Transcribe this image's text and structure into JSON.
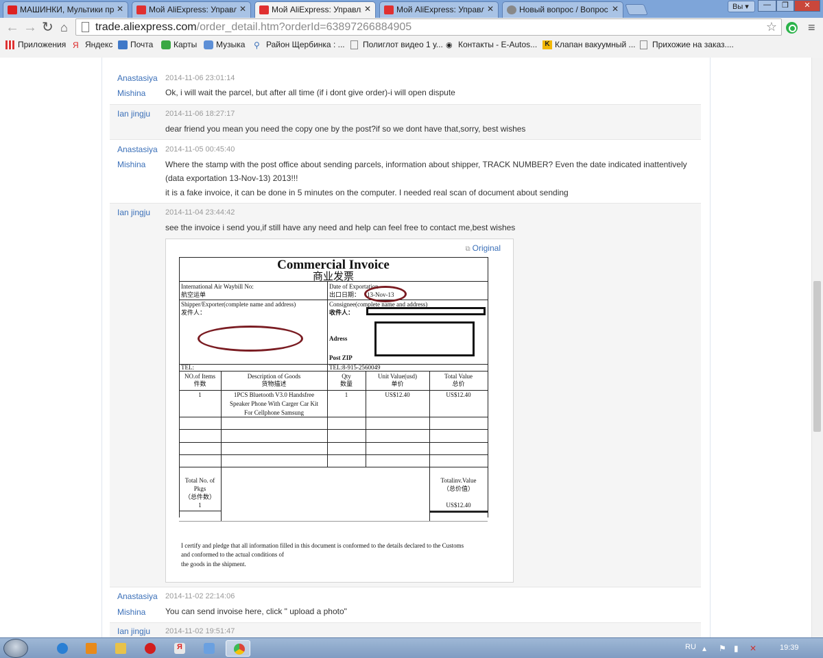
{
  "browser": {
    "tabs": [
      {
        "title": "МАШИНКИ, Мультики пр",
        "icon": "youtube-icon",
        "color": "#d22"
      },
      {
        "title": "Мой AliExpress: Управлят",
        "icon": "aliexpress-cart-icon",
        "color": "#e03030"
      },
      {
        "title": "Мой AliExpress: Управлят",
        "icon": "aliexpress-cart-icon",
        "color": "#e03030"
      },
      {
        "title": "Мой AliExpress: Управлят",
        "icon": "aliexpress-cart-icon",
        "color": "#e03030"
      },
      {
        "title": "Новый вопрос / Вопрос",
        "icon": "question-site-icon",
        "color": "#666"
      }
    ],
    "active_tab": 2,
    "profile_label": "Вы",
    "url_host": "trade.aliexpress.com",
    "url_path": "/order_detail.htm?orderId=63897266884905",
    "bookmarks": [
      {
        "label": "Приложения",
        "icon": "apps-grid-icon"
      },
      {
        "label": "Яндекс",
        "icon": "yandex-icon"
      },
      {
        "label": "Почта",
        "icon": "mail-icon"
      },
      {
        "label": "Карты",
        "icon": "maps-icon"
      },
      {
        "label": "Музыка",
        "icon": "music-icon"
      },
      {
        "label": "Район Щербинка : ...",
        "icon": "pin-icon"
      },
      {
        "label": "Полиглот видео 1 у...",
        "icon": "page-icon"
      },
      {
        "label": "Контакты - E-Autos...",
        "icon": "eye-icon"
      },
      {
        "label": "Клапан вакуумный ...",
        "icon": "k-icon"
      },
      {
        "label": "Прихожие на заказ....",
        "icon": "page-icon"
      }
    ]
  },
  "messages": [
    {
      "sender": [
        "Anastasiya",
        "Mishina"
      ],
      "time": "2014-11-06 23:01:14",
      "role": "buyer",
      "lines": [
        "Ok, i will wait the parcel, but after all time (if i dont give order)-i will open dispute"
      ]
    },
    {
      "sender": [
        "Ian jingju"
      ],
      "time": "2014-11-06 18:27:17",
      "role": "seller",
      "lines": [
        "dear friend you mean you need the copy one by the post?if so we dont have that,sorry, best wishes"
      ]
    },
    {
      "sender": [
        "Anastasiya",
        "Mishina"
      ],
      "time": "2014-11-05 00:45:40",
      "role": "buyer",
      "lines": [
        "Where the stamp with the post office about sending parcels, information about shipper, TRACK NUMBER? Even the date indicated inattentively (data exportation 13-Nov-13) 2013!!!",
        "it is a fake invoice, it can be done in 5 minutes on the computer. I needed real scan of document about sending"
      ]
    },
    {
      "sender": [
        "Ian jingju"
      ],
      "time": "2014-11-04 23:44:42",
      "role": "seller",
      "lines": [
        "see the invoice i send you,if still have any need and help can feel free to contact me,best wishes"
      ]
    },
    {
      "sender": [
        "Anastasiya",
        "Mishina"
      ],
      "time": "2014-11-02 22:14:06",
      "role": "buyer",
      "lines": [
        "You can send invoise here, click \" upload a photo\""
      ]
    },
    {
      "sender": [
        "Ian jingju"
      ],
      "time": "2014-11-02 19:51:47",
      "role": "seller",
      "lines": [
        ""
      ]
    }
  ],
  "attachment": {
    "original_link": "Original",
    "invoice": {
      "title": "Commercial Invoice",
      "title_cn": "商业发票",
      "waybill_label": "International Air Waybill No:",
      "waybill_label_cn": "航空运单",
      "date_label": "Date of Exportation",
      "date_label_cn": "出口日期：",
      "date_value": "13-Nov-13",
      "shipper_label": "Shipper/Exporter(complete name and address)",
      "shipper_label_cn": "发件人：",
      "consignee_label": "Consignee(complete name and address)",
      "consignee_label_cn": "收件人：",
      "address_label": "Adress",
      "zip_label": "Post ZIP",
      "tel_left": "TEL:",
      "tel_right": "TEL:8-915-2560049",
      "headers": [
        [
          "NO.of Items",
          "件数"
        ],
        [
          "Description of Goods",
          "货物描述"
        ],
        [
          "Qty",
          "数量"
        ],
        [
          "Unit Value(usd)",
          "单价"
        ],
        [
          "Total Value",
          "总价"
        ]
      ],
      "row": {
        "items": "1",
        "description": [
          "1PCS Bluetooth V3.0 Handsfree",
          "Speaker Phone With Carger Car Kit",
          "For Cellphone Samsung"
        ],
        "qty": "1",
        "unit": "US$12.40",
        "total": "US$12.40"
      },
      "total_pkgs_label": [
        "Total No. of",
        "Pkgs",
        "（总件数）"
      ],
      "total_pkgs": "1",
      "total_value_label": [
        "Totalinv.Value",
        "（总价值）"
      ],
      "total_value": "US$12.40",
      "certify": [
        "I certify and pledge that all information filled in this document is conformed to the details declared to the Customs",
        "and conformed to the actual conditions of",
        "the goods in the shipment."
      ]
    }
  },
  "taskbar": {
    "apps": [
      {
        "icon": "internet-explorer-icon",
        "color": "#2a7fd4"
      },
      {
        "icon": "media-player-icon",
        "color": "#e88a1a"
      },
      {
        "icon": "file-explorer-icon",
        "color": "#e8c24a"
      },
      {
        "icon": "opera-icon",
        "color": "#d21e1e"
      },
      {
        "icon": "yandex-browser-icon",
        "color": "#e8e8e8"
      },
      {
        "icon": "audio-icon",
        "color": "#6aa0e0"
      },
      {
        "icon": "chrome-icon",
        "color": "#3cba54"
      }
    ],
    "active_app": 6,
    "language": "RU",
    "clock": "19:39"
  }
}
